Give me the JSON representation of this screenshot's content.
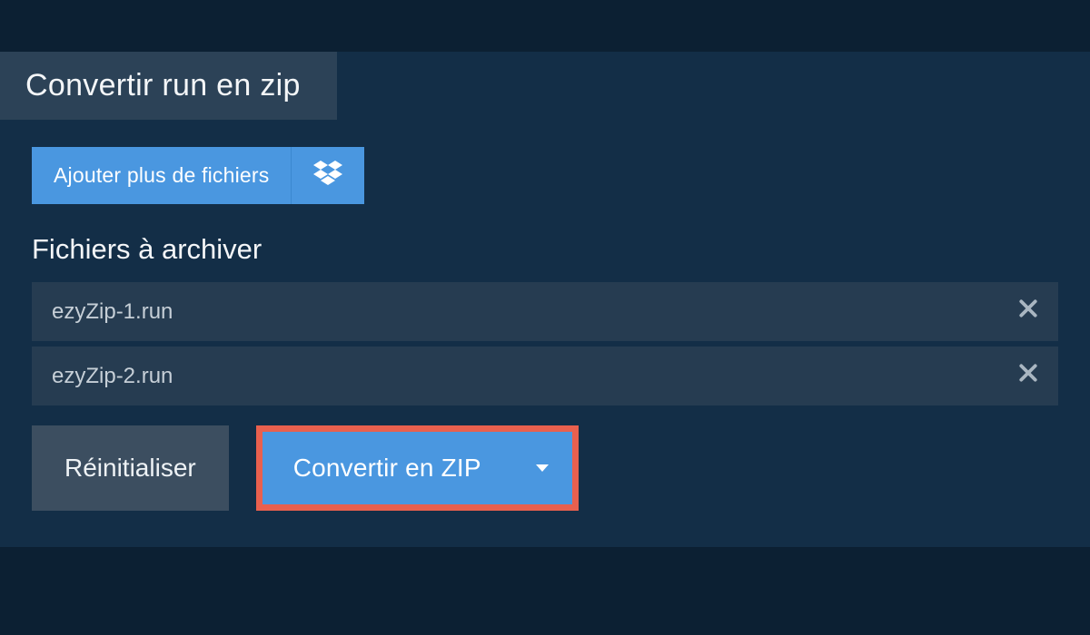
{
  "tab": {
    "title": "Convertir run en zip"
  },
  "add": {
    "label": "Ajouter plus de fichiers"
  },
  "section": {
    "title": "Fichiers à archiver"
  },
  "files": {
    "0": {
      "name": "ezyZip-1.run"
    },
    "1": {
      "name": "ezyZip-2.run"
    }
  },
  "actions": {
    "reset": "Réinitialiser",
    "convert": "Convertir en ZIP"
  }
}
